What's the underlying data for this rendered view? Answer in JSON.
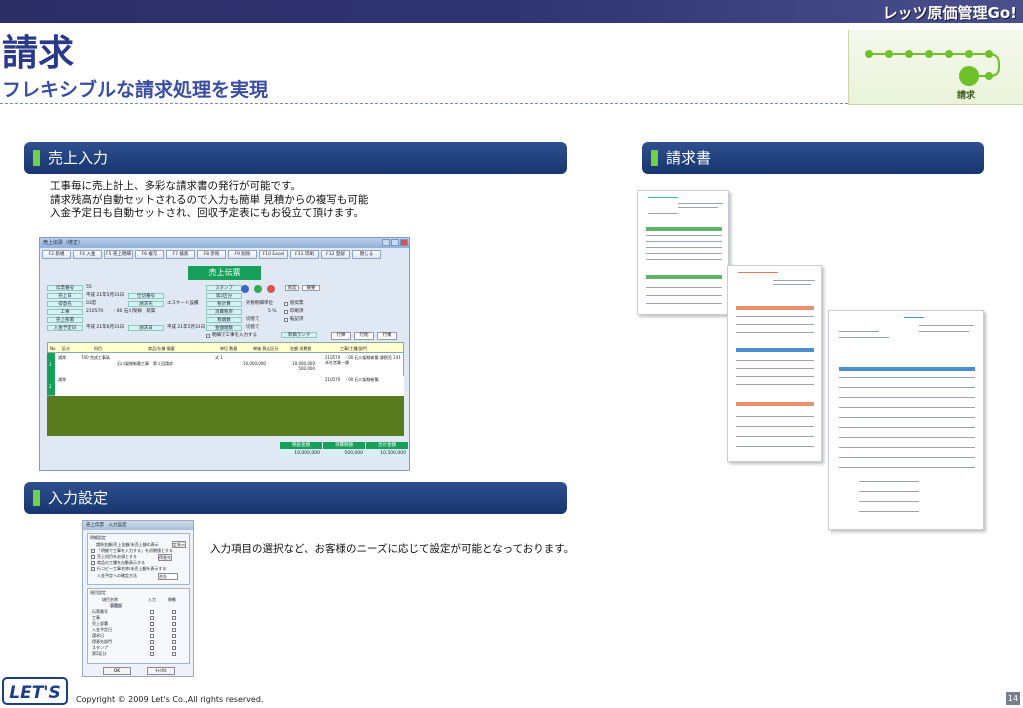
{
  "brand": "レッツ原価管理Go!",
  "title": "請求",
  "subtitle": "フレキシブルな請求処理を実現",
  "progress": {
    "label": "請求",
    "steps_total": 7,
    "current_step": 7
  },
  "sections": {
    "sales": {
      "label": "売上入力"
    },
    "invoice": {
      "label": "請求書"
    },
    "input_settings": {
      "label": "入力設定"
    }
  },
  "sales_description": [
    "工事毎に売上計上、多彩な請求書の発行が可能です。",
    "請求残高が自動セットされるので入力も簡単 見積からの複写も可能",
    "入金予定日も自動セットされ、回収予定表にもお役立て頂けます。"
  ],
  "settings_description": "入力項目の選択など、お客様のニーズに応じて設定が可能となっております。",
  "sales_window": {
    "title": "売上伝票（修正）",
    "header": "売上伝票",
    "fkeys": [
      "F2 新規",
      "F4 入金",
      "F5 売上明細",
      "F6 複写",
      "F7 検索",
      "F8 参照",
      "F9 削除",
      "F10 Excel",
      "F11 印刷",
      "F12 登録",
      "閉じる"
    ],
    "fields": [
      {
        "label": "伝票番号",
        "value": "55"
      },
      {
        "label": "売上日",
        "value": "平成 21年5月31日"
      },
      {
        "label": "得意先",
        "value": "03宏"
      },
      {
        "label": "工事",
        "value": "210570 　　- 00 石川架線　新築"
      },
      {
        "label": "売上部署",
        "value": ""
      },
      {
        "label": "入金予定日",
        "value": "平成 21年6月31日"
      }
    ],
    "right_fields": [
      {
        "label": "仕切番号",
        "value": ""
      },
      {
        "label": "請求先",
        "value": "エスケート設備"
      },
      {
        "label": "請求日",
        "value": "平成 21年5月31日"
      },
      {
        "label": "消費税率",
        "value": "5 %"
      },
      {
        "label": "税端数",
        "value": "切捨て"
      },
      {
        "label": "金額端数",
        "value": "切捨て"
      }
    ],
    "stamp_labels": [
      "スタンプ",
      "第2区分",
      "税計算",
      "承認"
    ],
    "checks": [
      "仮伝票",
      "印刷済",
      "転記済"
    ],
    "checkbox_label": "明細で工事を入力する",
    "rank_label": "単価ランク",
    "buttons": [
      "行挿",
      "行削",
      "行複"
    ],
    "grid_headers": [
      "No",
      "区分",
      "科目",
      "商品/仕様 摘要",
      "単位 数量",
      "単価 税込区分",
      "金額 消費税",
      "工事/工種/部門"
    ],
    "rows": [
      {
        "no": "1",
        "kubun": "通常",
        "kamoku": "700 完成工事高",
        "tekiyo": "石川架線新築工事　第１回請求",
        "unit": "式 1",
        "price": "10,000,000",
        "amount": "10,000,000 500,000",
        "koji": "210570 　- 00 石川架線新築 課税売 141 本社営業一課"
      },
      {
        "no": "2",
        "kubun": "通常",
        "kamoku": "",
        "tekiyo": "",
        "unit": "",
        "price": "",
        "amount": "",
        "koji": "210570 　- 00 石川架線新築"
      }
    ],
    "totals": [
      {
        "label": "税抜金額",
        "value": "10,000,000"
      },
      {
        "label": "消費税額",
        "value": "500,000"
      },
      {
        "label": "合計金額",
        "value": "10,500,000"
      }
    ]
  },
  "settings_window": {
    "title": "売上伝票　入力設定",
    "group1": "明細設定",
    "options": [
      "請負金額/売上金額/未売上額の表示",
      "「明細で工事を入力する」を初期値とする",
      "売上科目を必須とする",
      "商品の工種を自動表示する",
      "行コピー工事名称/未売上額を表示する",
      "入金予定への確定方法"
    ],
    "option_values": [
      "定表示",
      "",
      "得意先",
      "",
      "",
      "合計"
    ],
    "group2": "項目設定",
    "item_headers": [
      "項目名称",
      "入力",
      "移動"
    ],
    "item_group": "表題部",
    "items": [
      "伝票番号",
      "工事",
      "売上部署",
      "入金予定日",
      "請求日",
      "得意先部門",
      "スタンプ",
      "第2区分"
    ],
    "ok": "OK",
    "cancel": "ｷｬﾝｾﾙ"
  },
  "colors": {
    "accent": "#17366f",
    "green": "#6ed14a",
    "title": "#2a3a8a"
  },
  "logo_text": "LET'S",
  "copyright": "Copyright © 2009 Let's Co.,All rights reserved.",
  "page_number": "14"
}
